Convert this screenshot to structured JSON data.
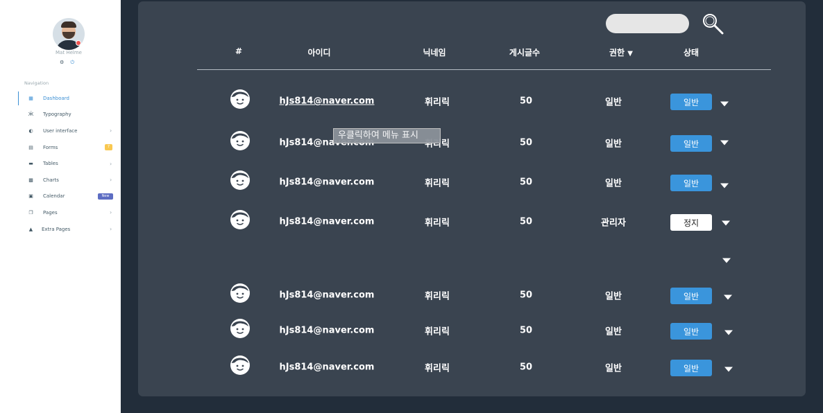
{
  "sidebar": {
    "user_name": "Mat Helme",
    "nav_title": "Navigation",
    "items": [
      {
        "label": "Dashboard",
        "icon": "dashboard-icon"
      },
      {
        "label": "Typography",
        "icon": "typography-icon"
      },
      {
        "label": "User interface",
        "icon": "ui-icon"
      },
      {
        "label": "Forms",
        "icon": "forms-icon",
        "badge": "7"
      },
      {
        "label": "Tables",
        "icon": "tables-icon"
      },
      {
        "label": "Charts",
        "icon": "charts-icon"
      },
      {
        "label": "Calendar",
        "icon": "calendar-icon",
        "badge": "New"
      },
      {
        "label": "Pages",
        "icon": "pages-icon"
      },
      {
        "label": "Extra Pages",
        "icon": "extra-pages-icon"
      }
    ]
  },
  "search": {
    "placeholder": ""
  },
  "table": {
    "headers": {
      "num": "#",
      "id": "아이디",
      "nickname": "닉네임",
      "posts": "게시글수",
      "role": "권한",
      "status": "상태"
    },
    "rows": [
      {
        "email": "hJs814@naver.com",
        "nickname": "휘리릭",
        "posts": "50",
        "role": "일반",
        "status": "일반"
      },
      {
        "email": "hJs814@naver.com",
        "nickname": "휘리릭",
        "posts": "50",
        "role": "일반",
        "status": "일반"
      },
      {
        "email": "hJs814@naver.com",
        "nickname": "휘리릭",
        "posts": "50",
        "role": "일반",
        "status": "일반"
      },
      {
        "email": "hJs814@naver.com",
        "nickname": "휘리릭",
        "posts": "50",
        "role": "관리자",
        "status": "정지"
      },
      {
        "email": "hJs814@naver.com",
        "nickname": "휘리릭",
        "posts": "50",
        "role": "일반",
        "status": "일반"
      },
      {
        "email": "hJs814@naver.com",
        "nickname": "휘리릭",
        "posts": "50",
        "role": "일반",
        "status": "일반"
      },
      {
        "email": "hJs814@naver.com",
        "nickname": "휘리릭",
        "posts": "50",
        "role": "일반",
        "status": "일반"
      }
    ]
  },
  "tooltip": "우클릭하여 메뉴 표시",
  "colors": {
    "panel": "#3a4450",
    "background": "#222d3a",
    "accent": "#3a95dc",
    "nav_active": "#3b8fd4"
  }
}
